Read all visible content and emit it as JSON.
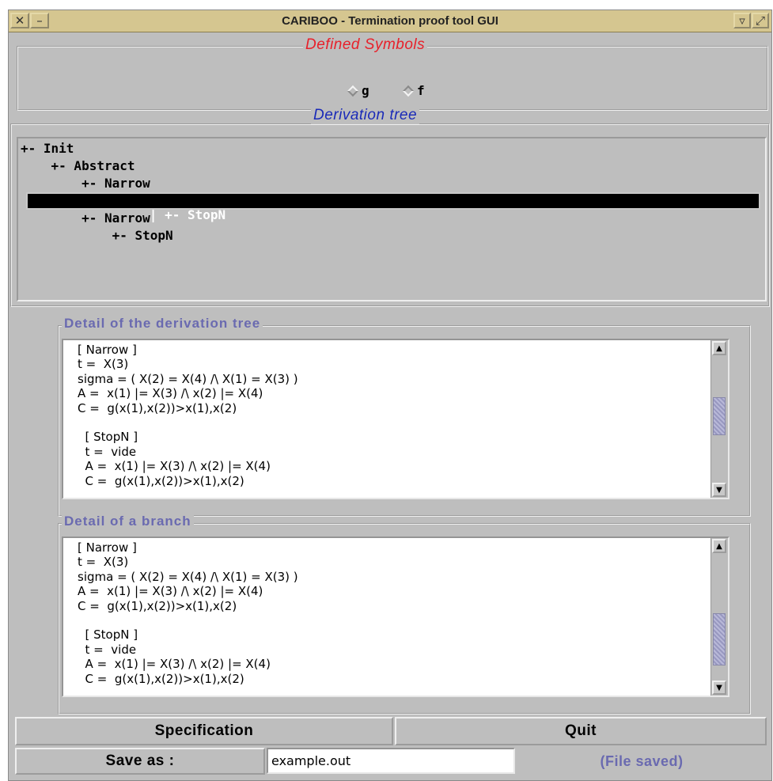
{
  "window": {
    "title": "CARIBOO - Termination proof tool GUI",
    "close_glyph": "✕",
    "minimize_glyph": "–",
    "right_glyph_1": "▿",
    "right_glyph_2": "⤢"
  },
  "symbols": {
    "legend": "Defined Symbols",
    "legend_color": "#e8202a",
    "options": [
      {
        "label": "g",
        "selected": true
      },
      {
        "label": "f",
        "selected": false
      }
    ]
  },
  "tree": {
    "legend": "Derivation tree",
    "legend_color": "#1a2ab8",
    "rows": [
      {
        "text": "+- Init",
        "selected": false
      },
      {
        "text": "    +- Abstract",
        "selected": false
      },
      {
        "text": "        +- Narrow",
        "selected": false
      },
      {
        "text": "| +- StopN",
        "selected": true
      },
      {
        "text": "        +- Narrow",
        "selected": false
      },
      {
        "text": "            +- StopN",
        "selected": false
      }
    ]
  },
  "detail_tree": {
    "legend": "Detail of the derivation tree",
    "legend_color": "#6a6ab0",
    "text": "[ Narrow ]\nt =  X(3)\nsigma = ( X(2) = X(4) /\\ X(1) = X(3) )\nA =  x(1) |= X(3) /\\ x(2) |= X(4)\nC =  g(x(1),x(2))>x(1),x(2)\n\n  [ StopN ]\n  t =  vide\n  A =  x(1) |= X(3) /\\ x(2) |= X(4)\n  C =  g(x(1),x(2))>x(1),x(2)"
  },
  "detail_branch": {
    "legend": "Detail of a branch",
    "legend_color": "#6a6ab0",
    "text": "[ Narrow ]\nt =  X(3)\nsigma = ( X(2) = X(4) /\\ X(1) = X(3) )\nA =  x(1) |= X(3) /\\ x(2) |= X(4)\nC =  g(x(1),x(2))>x(1),x(2)\n\n  [ StopN ]\n  t =  vide\n  A =  x(1) |= X(3) /\\ x(2) |= X(4)\n  C =  g(x(1),x(2))>x(1),x(2)"
  },
  "buttons": {
    "specification": "Specification",
    "quit": "Quit",
    "save_as": "Save as :"
  },
  "save": {
    "filename": "example.out",
    "status": "(File saved)",
    "status_color": "#6a6ab0"
  },
  "scroll_glyphs": {
    "up": "▲",
    "down": "▼"
  }
}
